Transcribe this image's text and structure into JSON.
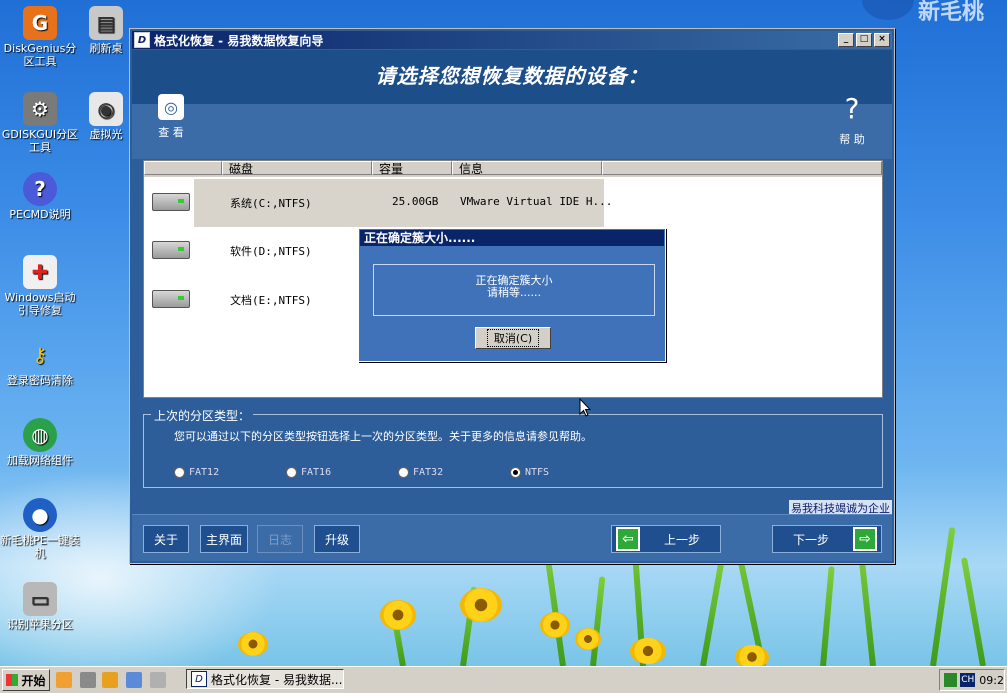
{
  "desktop": {
    "icons": [
      {
        "label": "DiskGenius分区工具"
      },
      {
        "label": "刷新桌"
      },
      {
        "label": "GDISKGUI分区工具"
      },
      {
        "label": "虚拟光"
      },
      {
        "label": "PECMD说明"
      },
      {
        "label": "Windows启动引导修复"
      },
      {
        "label": "登录密码清除"
      },
      {
        "label": "加载网络组件"
      },
      {
        "label": "新毛桃PE一键装机"
      },
      {
        "label": "识别苹果分区"
      }
    ],
    "brand": "新毛桃"
  },
  "window": {
    "title": "格式化恢复 - 易我数据恢复向导",
    "controls": {
      "minimize": "_",
      "maximize": "□",
      "close": "×"
    },
    "banner_title": "请选择您想恢复数据的设备：",
    "toolbar": {
      "view_label": "查 看",
      "help_label": "帮 助"
    },
    "table": {
      "columns": [
        "磁盘",
        "容量",
        "信息"
      ],
      "rows": [
        {
          "disk": "系统(C:,NTFS)",
          "capacity": "25.00GB",
          "info": "VMware Virtual IDE H...",
          "selected": true
        },
        {
          "disk": "软件(D:,NTFS)",
          "capacity": "",
          "info": "",
          "selected": false
        },
        {
          "disk": "文档(E:,NTFS)",
          "capacity": "",
          "info": "",
          "selected": false
        }
      ]
    },
    "partition_group": {
      "legend": "上次的分区类型：",
      "description": "您可以通过以下的分区类型按钮选择上一次的分区类型。关于更多的信息请参见帮助。",
      "options": [
        "FAT12",
        "FAT16",
        "FAT32",
        "NTFS"
      ],
      "selected": "NTFS"
    },
    "company_text": "易我科技竭诚为企业",
    "buttons": {
      "about": "关于",
      "main": "主界面",
      "log": "日志",
      "upgrade": "升级",
      "prev": "上一步",
      "next": "下一步"
    }
  },
  "dialog": {
    "title": "正在确定簇大小......",
    "line1": "正在确定簇大小",
    "line2": "请稍等......",
    "cancel": "取消(C)"
  },
  "taskbar": {
    "start": "开始",
    "task_label": "格式化恢复 - 易我数据...",
    "lang": "CH",
    "clock": "09:2"
  }
}
